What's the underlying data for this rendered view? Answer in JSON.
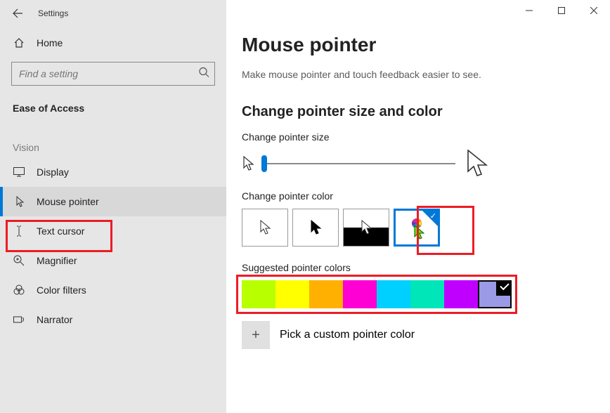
{
  "window": {
    "app_title": "Settings"
  },
  "sidebar": {
    "home_label": "Home",
    "search_placeholder": "Find a setting",
    "category_label": "Ease of Access",
    "group_label": "Vision",
    "items": [
      {
        "label": "Display",
        "icon": "display-icon",
        "active": false
      },
      {
        "label": "Mouse pointer",
        "icon": "pointer-icon",
        "active": true
      },
      {
        "label": "Text cursor",
        "icon": "text-cursor-icon",
        "active": false
      },
      {
        "label": "Magnifier",
        "icon": "magnifier-icon",
        "active": false
      },
      {
        "label": "Color filters",
        "icon": "color-filters-icon",
        "active": false
      },
      {
        "label": "Narrator",
        "icon": "narrator-icon",
        "active": false
      }
    ]
  },
  "main": {
    "page_title": "Mouse pointer",
    "description": "Make mouse pointer and touch feedback easier to see.",
    "section_heading": "Change pointer size and color",
    "size_label": "Change pointer size",
    "slider_value": 0,
    "color_label": "Change pointer color",
    "color_options": [
      {
        "name": "white",
        "selected": false
      },
      {
        "name": "black",
        "selected": false
      },
      {
        "name": "inverted",
        "selected": false
      },
      {
        "name": "custom-color",
        "selected": true
      }
    ],
    "suggested_label": "Suggested pointer colors",
    "suggested_colors": [
      {
        "hex": "#b8ff00",
        "selected": false
      },
      {
        "hex": "#ffff00",
        "selected": false
      },
      {
        "hex": "#ffb000",
        "selected": false
      },
      {
        "hex": "#ff00d4",
        "selected": false
      },
      {
        "hex": "#00d0ff",
        "selected": false
      },
      {
        "hex": "#00e6b8",
        "selected": false
      },
      {
        "hex": "#c000ff",
        "selected": false
      },
      {
        "hex": "#9a9ae6",
        "selected": true
      }
    ],
    "custom_color_label": "Pick a custom pointer color"
  },
  "annotations": {
    "highlight_nav": "Mouse pointer",
    "highlight_tile": "custom-color",
    "highlight_swatches": true
  }
}
